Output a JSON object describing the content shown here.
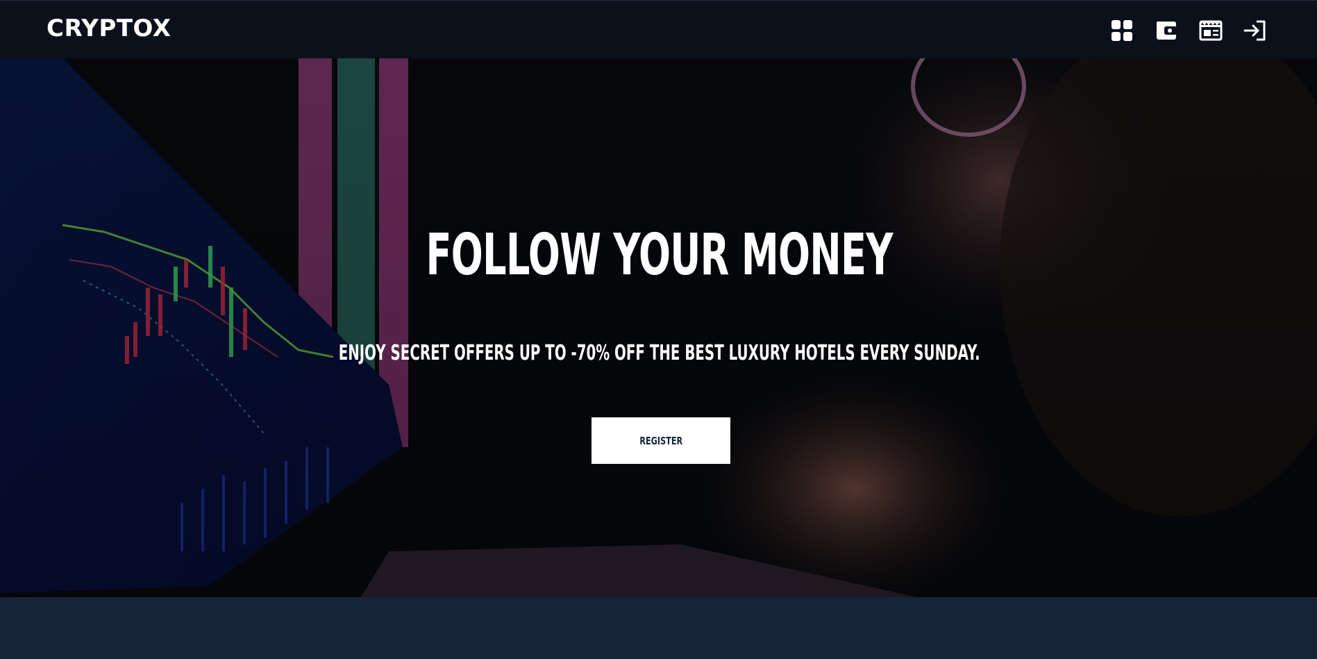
{
  "nav": {
    "logo": "CRYPTOX",
    "icons": [
      "dashboard-icon",
      "wallet-icon",
      "news-icon",
      "login-icon"
    ]
  },
  "hero": {
    "title": "FOLLOW YOUR MONEY",
    "subtitle": "ENJOY SECRET OFFERS UP TO -70% OFF THE BEST LUXURY HOTELS EVERY SUNDAY.",
    "register_label": "REGISTER"
  },
  "colors": {
    "navbar_bg": "#0a111b",
    "footer_bg": "#16243a",
    "text": "#ffffff",
    "button_bg": "#ffffff",
    "button_text": "#16243a"
  }
}
